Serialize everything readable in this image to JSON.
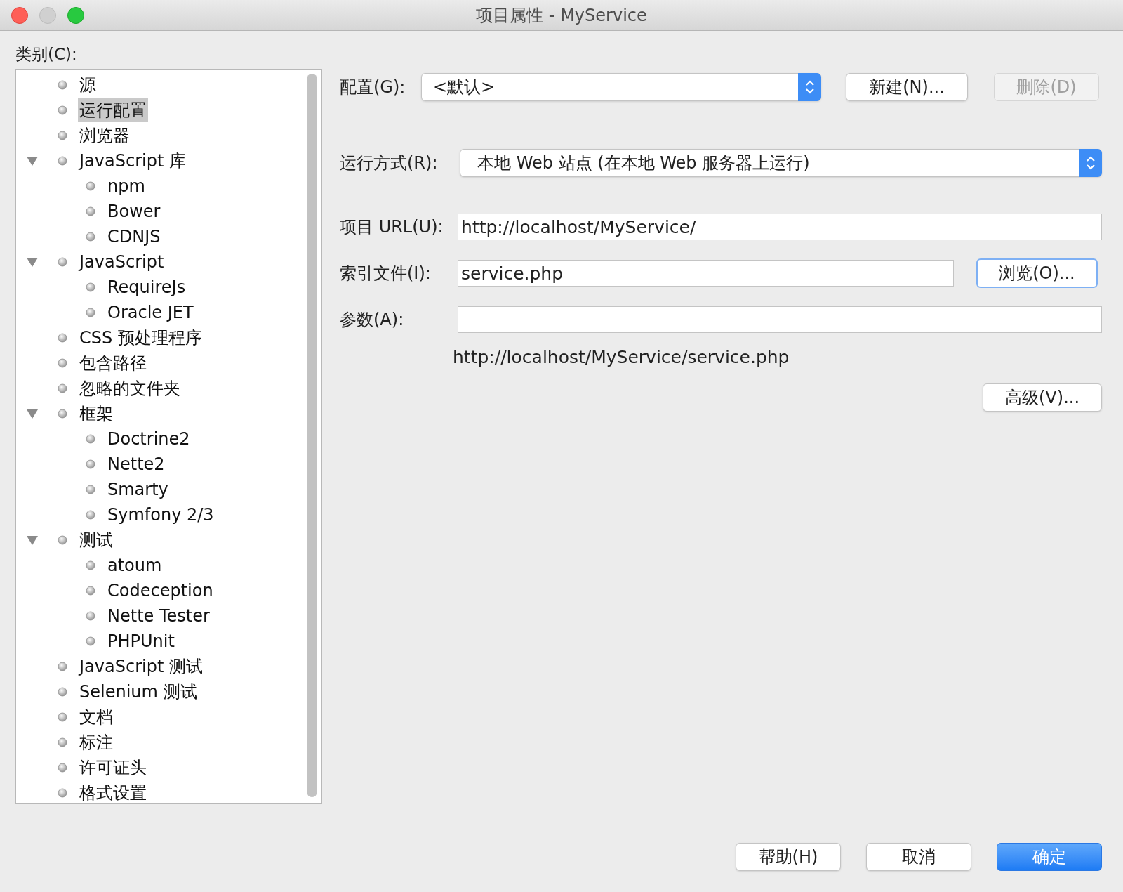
{
  "window": {
    "title": "项目属性 - MyService"
  },
  "categories": {
    "label": "类别(C):",
    "items": [
      {
        "label": "源",
        "selected": false
      },
      {
        "label": "运行配置",
        "selected": true
      },
      {
        "label": "浏览器",
        "selected": false
      },
      {
        "label": "JavaScript 库",
        "selected": false,
        "expanded": true,
        "children": [
          {
            "label": "npm",
            "selected": false
          },
          {
            "label": "Bower",
            "selected": false
          },
          {
            "label": "CDNJS",
            "selected": false
          }
        ]
      },
      {
        "label": "JavaScript",
        "selected": false,
        "expanded": true,
        "children": [
          {
            "label": "RequireJs",
            "selected": false
          },
          {
            "label": "Oracle JET",
            "selected": false
          }
        ]
      },
      {
        "label": "CSS 预处理程序",
        "selected": false
      },
      {
        "label": "包含路径",
        "selected": false
      },
      {
        "label": "忽略的文件夹",
        "selected": false
      },
      {
        "label": "框架",
        "selected": false,
        "expanded": true,
        "children": [
          {
            "label": "Doctrine2",
            "selected": false
          },
          {
            "label": "Nette2",
            "selected": false
          },
          {
            "label": "Smarty",
            "selected": false
          },
          {
            "label": "Symfony 2/3",
            "selected": false
          }
        ]
      },
      {
        "label": "测试",
        "selected": false,
        "expanded": true,
        "children": [
          {
            "label": "atoum",
            "selected": false
          },
          {
            "label": "Codeception",
            "selected": false
          },
          {
            "label": "Nette Tester",
            "selected": false
          },
          {
            "label": "PHPUnit",
            "selected": false
          }
        ]
      },
      {
        "label": "JavaScript 测试",
        "selected": false
      },
      {
        "label": "Selenium 测试",
        "selected": false
      },
      {
        "label": "文档",
        "selected": false
      },
      {
        "label": "标注",
        "selected": false
      },
      {
        "label": "许可证头",
        "selected": false
      },
      {
        "label": "格式设置",
        "selected": false
      }
    ]
  },
  "configuration": {
    "label": "配置(G):",
    "value": "<默认>",
    "new_button": "新建(N)...",
    "delete_button": {
      "label": "删除(D)",
      "disabled": true
    }
  },
  "run_as": {
    "label": "运行方式(R):",
    "value": "本地 Web 站点 (在本地 Web 服务器上运行)"
  },
  "project_url": {
    "label": "项目 URL(U):",
    "value": "http://localhost/MyService/"
  },
  "index_file": {
    "label": "索引文件(I):",
    "value": "service.php",
    "browse_button": "浏览(O)..."
  },
  "arguments": {
    "label": "参数(A):"
  },
  "resolved_url": "http://localhost/MyService/service.php",
  "advanced_button": "高级(V)...",
  "buttons": [
    {
      "label": "帮助(H)",
      "kind": "normal"
    },
    {
      "label": "取消",
      "kind": "normal"
    },
    {
      "label": "确定",
      "kind": "default"
    }
  ]
}
